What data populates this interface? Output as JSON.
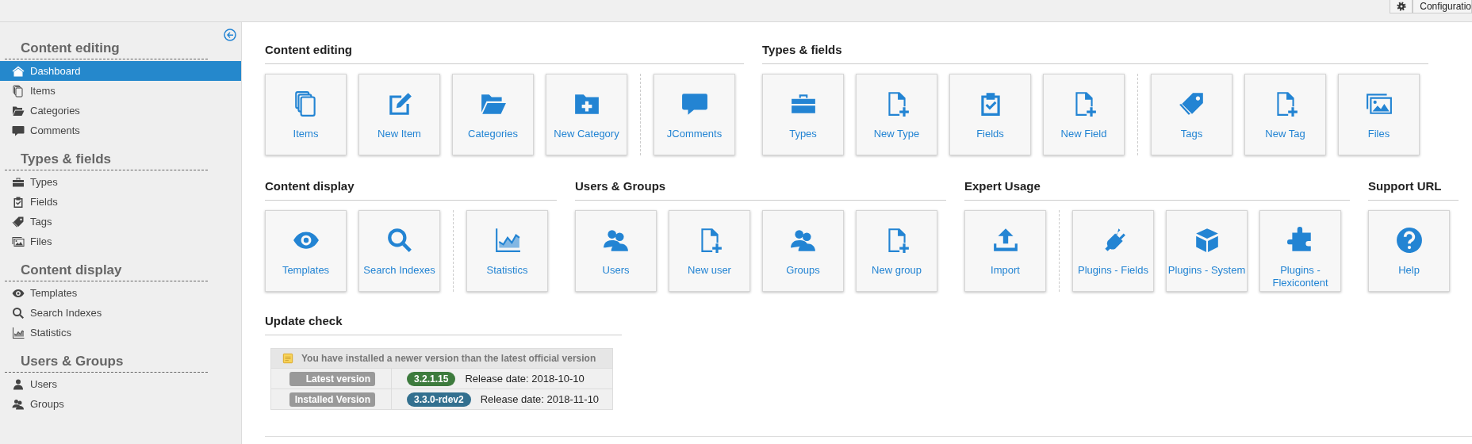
{
  "top_bar": {
    "config_button": {
      "label": "Configuratio"
    }
  },
  "sidebar": {
    "sections": [
      {
        "title": "Content editing",
        "items": [
          {
            "label": "Dashboard",
            "selected": true
          },
          {
            "label": "Items",
            "selected": false
          },
          {
            "label": "Categories",
            "selected": false
          },
          {
            "label": "Comments",
            "selected": false
          }
        ]
      },
      {
        "title": "Types & fields",
        "items": [
          {
            "label": "Types",
            "selected": false
          },
          {
            "label": "Fields",
            "selected": false
          },
          {
            "label": "Tags",
            "selected": false
          },
          {
            "label": "Files",
            "selected": false
          }
        ]
      },
      {
        "title": "Content display",
        "items": [
          {
            "label": "Templates",
            "selected": false
          },
          {
            "label": "Search Indexes",
            "selected": false
          },
          {
            "label": "Statistics",
            "selected": false
          }
        ]
      },
      {
        "title": "Users & Groups",
        "items": [
          {
            "label": "Users",
            "selected": false
          },
          {
            "label": "Groups",
            "selected": false
          }
        ]
      }
    ]
  },
  "dashboard": {
    "rows": [
      {
        "sections": [
          {
            "title": "Content editing",
            "groups": [
              {
                "tiles": [
                  {
                    "label": "Items"
                  },
                  {
                    "label": "New Item"
                  },
                  {
                    "label": "Categories"
                  },
                  {
                    "label": "New Category"
                  }
                ]
              },
              {
                "tiles": [
                  {
                    "label": "JComments"
                  }
                ]
              }
            ]
          },
          {
            "title": "Types & fields",
            "groups": [
              {
                "tiles": [
                  {
                    "label": "Types"
                  },
                  {
                    "label": "New Type"
                  },
                  {
                    "label": "Fields"
                  },
                  {
                    "label": "New Field"
                  }
                ]
              },
              {
                "tiles": [
                  {
                    "label": "Tags"
                  },
                  {
                    "label": "New Tag"
                  },
                  {
                    "label": "Files"
                  }
                ]
              }
            ]
          }
        ]
      },
      {
        "sections": [
          {
            "title": "Content display",
            "groups": [
              {
                "tiles": [
                  {
                    "label": "Templates"
                  },
                  {
                    "label": "Search Indexes"
                  }
                ]
              },
              {
                "tiles": [
                  {
                    "label": "Statistics"
                  }
                ]
              }
            ]
          },
          {
            "title": "Users & Groups",
            "groups": [
              {
                "tiles": [
                  {
                    "label": "Users"
                  },
                  {
                    "label": "New user"
                  },
                  {
                    "label": "Groups"
                  },
                  {
                    "label": "New group"
                  }
                ]
              }
            ]
          },
          {
            "title": "Expert Usage",
            "groups": [
              {
                "tiles": [
                  {
                    "label": "Import"
                  }
                ]
              },
              {
                "tiles": [
                  {
                    "label": "Plugins - Fields"
                  },
                  {
                    "label": "Plugins - System"
                  },
                  {
                    "label": "Plugins - Flexicontent"
                  }
                ]
              }
            ]
          },
          {
            "title": "Support URL",
            "groups": [
              {
                "tiles": [
                  {
                    "label": "Help"
                  }
                ]
              }
            ]
          }
        ]
      }
    ]
  },
  "update_check": {
    "title": "Update check",
    "notice": "You have installed a newer version than the latest official version",
    "rows": [
      {
        "label": "Latest version",
        "version": "3.2.1.15",
        "color": "#3d7b3d",
        "release": "Release date: 2018-10-10"
      },
      {
        "label": "Installed Version",
        "version": "3.3.0-rdev2",
        "color": "#33708f",
        "release": "Release date: 2018-11-10"
      }
    ]
  }
}
